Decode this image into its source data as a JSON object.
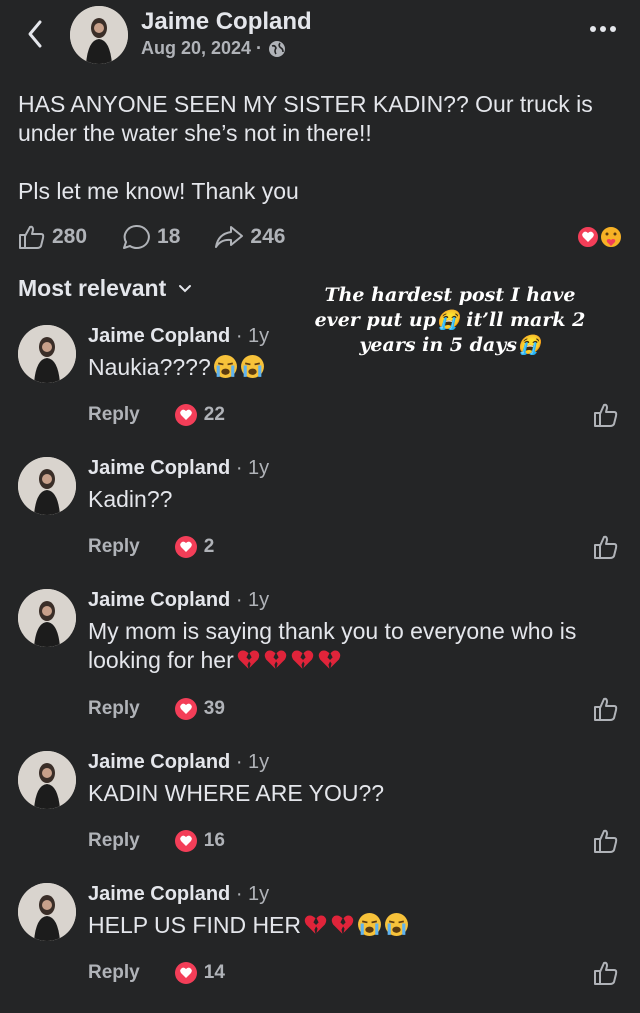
{
  "post": {
    "author": "Jaime Copland",
    "date": "Aug 20, 2024 ·",
    "text_line1": "HAS ANYONE SEEN MY SISTER KADIN?? Our truck is under the water she’s not in there!!",
    "text_line2": "Pls let me know! Thank you",
    "likes": "280",
    "comments": "18",
    "shares": "246"
  },
  "sort_label": "Most relevant",
  "overlay_text": "The hardest post I have ever put up😭 it’ll mark 2 years in 5 days😭",
  "comments": [
    {
      "author": "Jaime Copland",
      "age": "· 1y",
      "text": "Naukia????",
      "emojis": [
        "loudly-crying",
        "loudly-crying"
      ],
      "reply": "Reply",
      "count": "22"
    },
    {
      "author": "Jaime Copland",
      "age": "· 1y",
      "text": "Kadin??",
      "emojis": [],
      "reply": "Reply",
      "count": "2"
    },
    {
      "author": "Jaime Copland",
      "age": "· 1y",
      "text": "My mom is saying thank you to everyone who is looking for her",
      "emojis": [
        "broken-heart",
        "broken-heart",
        "broken-heart",
        "broken-heart"
      ],
      "reply": "Reply",
      "count": "39"
    },
    {
      "author": "Jaime Copland",
      "age": "· 1y",
      "text": "KADIN WHERE ARE YOU??",
      "emojis": [],
      "reply": "Reply",
      "count": "16"
    },
    {
      "author": "Jaime Copland",
      "age": "· 1y",
      "text": "HELP US FIND HER",
      "emojis": [
        "broken-heart",
        "broken-heart",
        "loudly-crying",
        "loudly-crying"
      ],
      "reply": "Reply",
      "count": "14"
    }
  ],
  "colors": {
    "background": "#242526",
    "text": "#e4e6eb",
    "muted": "#b0b3b8",
    "heart": "#f33e58"
  }
}
